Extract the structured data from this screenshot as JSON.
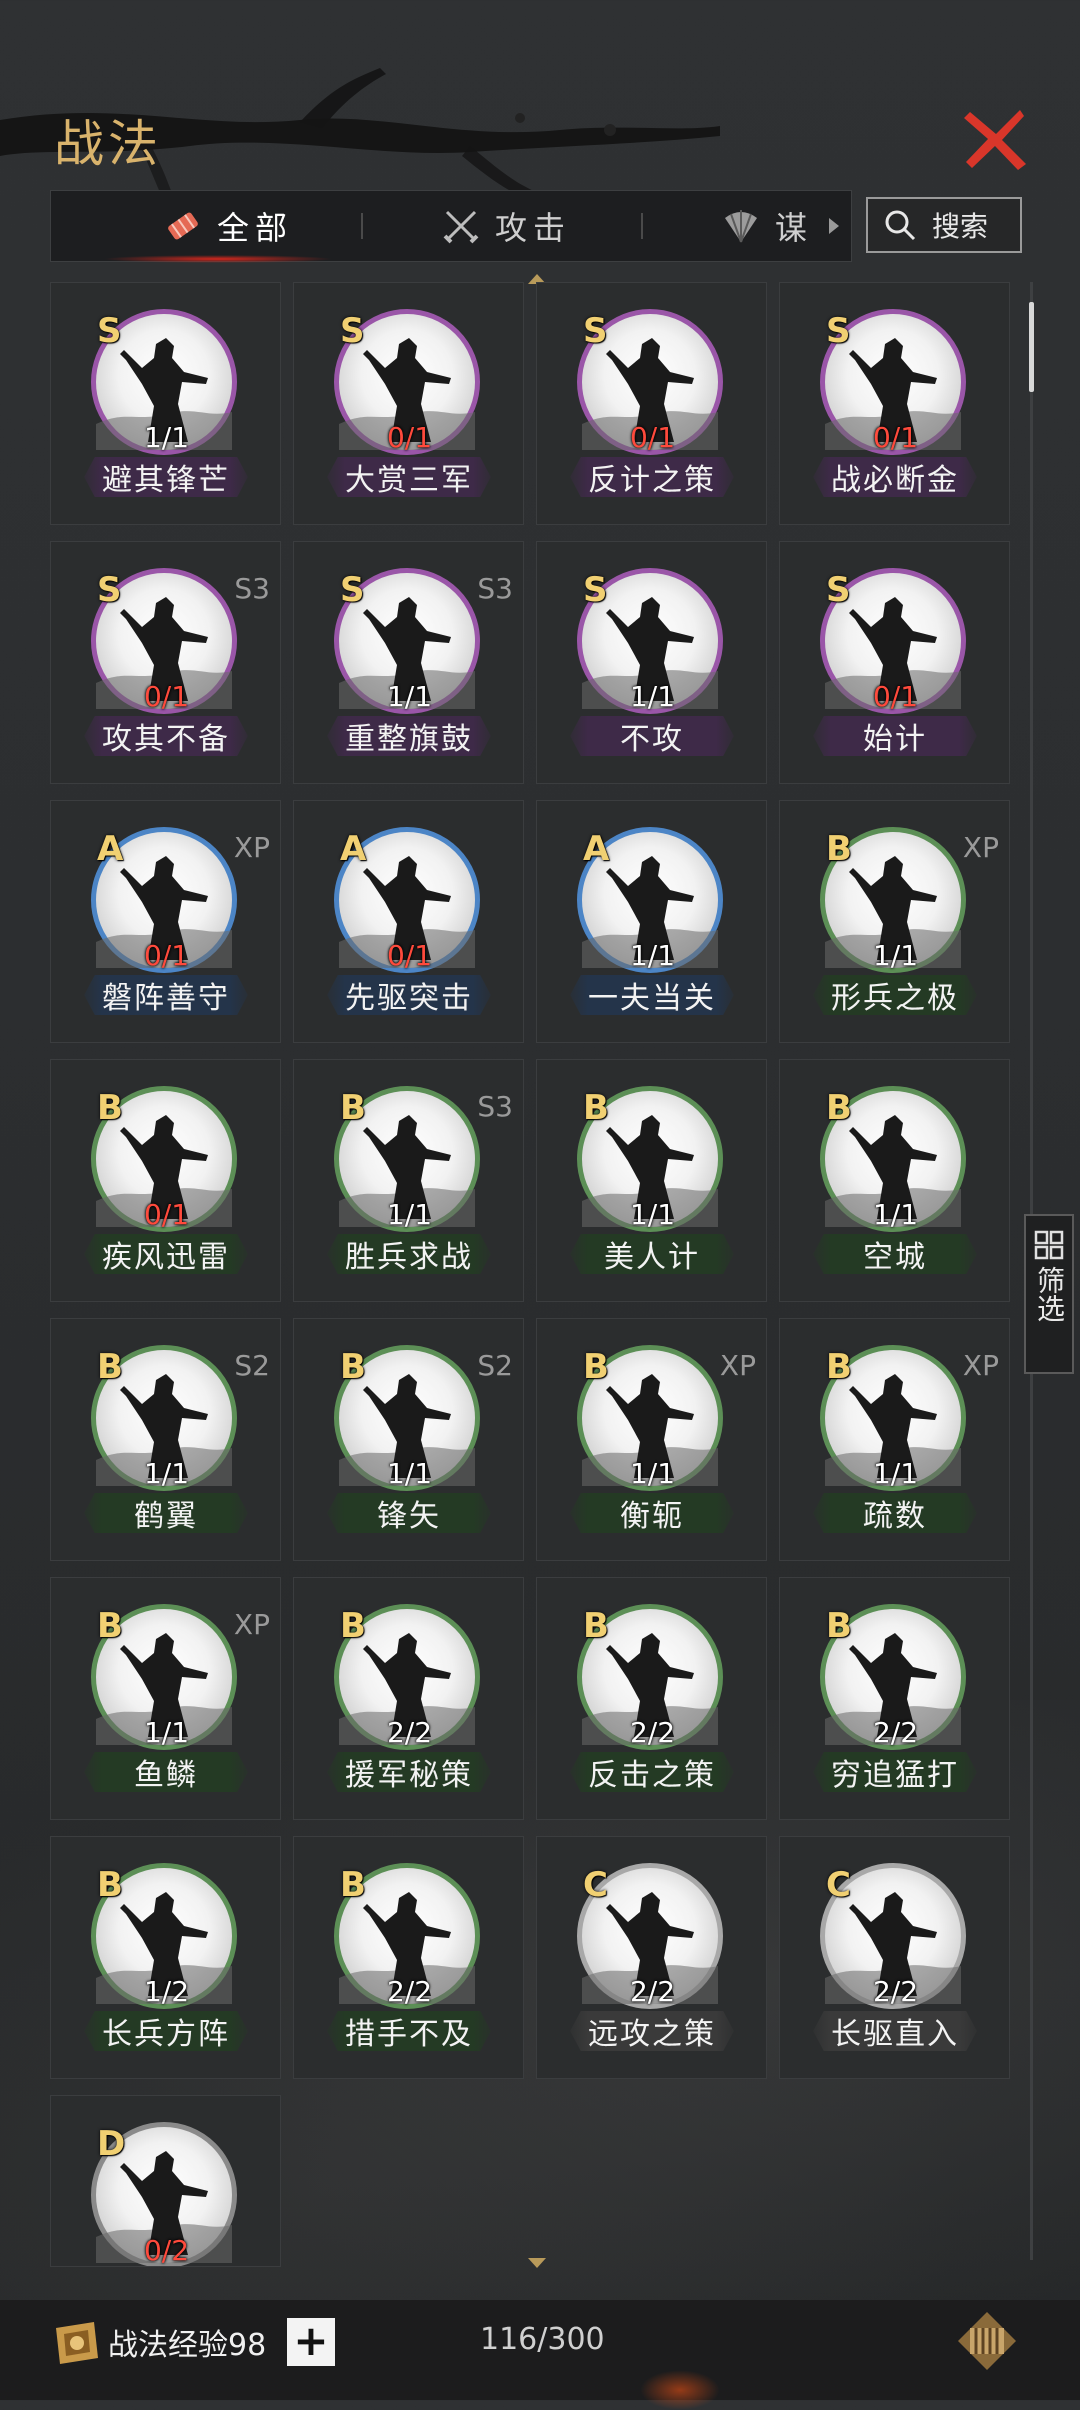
{
  "header": {
    "title": "战法"
  },
  "tabs": [
    {
      "label": "全部",
      "icon": "scroll-icon",
      "active": true
    },
    {
      "label": "攻击",
      "icon": "crossed-swords-icon",
      "active": false
    },
    {
      "label": "谋",
      "icon": "fan-icon",
      "active": false
    }
  ],
  "search": {
    "label": "搜索"
  },
  "filter": {
    "label": "筛选"
  },
  "colors": {
    "S": "#9a56a8",
    "A": "#4c85c6",
    "B": "#5c8f56",
    "C": "#a8a8a8",
    "D": "#8a8a8a",
    "accent": "#d9b36c",
    "close": "#d9362a",
    "count_red": "#ff4a3c"
  },
  "cards": [
    {
      "grade": "S",
      "tag": "",
      "count": "1/1",
      "red": false,
      "name": "避其锋芒"
    },
    {
      "grade": "S",
      "tag": "",
      "count": "0/1",
      "red": true,
      "name": "大赏三军"
    },
    {
      "grade": "S",
      "tag": "",
      "count": "0/1",
      "red": true,
      "name": "反计之策"
    },
    {
      "grade": "S",
      "tag": "",
      "count": "0/1",
      "red": true,
      "name": "战必断金"
    },
    {
      "grade": "S",
      "tag": "S3",
      "count": "0/1",
      "red": true,
      "name": "攻其不备"
    },
    {
      "grade": "S",
      "tag": "S3",
      "count": "1/1",
      "red": false,
      "name": "重整旗鼓"
    },
    {
      "grade": "S",
      "tag": "",
      "count": "1/1",
      "red": false,
      "name": "不攻"
    },
    {
      "grade": "S",
      "tag": "",
      "count": "0/1",
      "red": true,
      "name": "始计"
    },
    {
      "grade": "A",
      "tag": "XP",
      "count": "0/1",
      "red": true,
      "name": "磐阵善守"
    },
    {
      "grade": "A",
      "tag": "",
      "count": "0/1",
      "red": true,
      "name": "先驱突击"
    },
    {
      "grade": "A",
      "tag": "",
      "count": "1/1",
      "red": false,
      "name": "一夫当关"
    },
    {
      "grade": "B",
      "tag": "XP",
      "count": "1/1",
      "red": false,
      "name": "形兵之极"
    },
    {
      "grade": "B",
      "tag": "",
      "count": "0/1",
      "red": true,
      "name": "疾风迅雷"
    },
    {
      "grade": "B",
      "tag": "S3",
      "count": "1/1",
      "red": false,
      "name": "胜兵求战"
    },
    {
      "grade": "B",
      "tag": "",
      "count": "1/1",
      "red": false,
      "name": "美人计"
    },
    {
      "grade": "B",
      "tag": "",
      "count": "1/1",
      "red": false,
      "name": "空城"
    },
    {
      "grade": "B",
      "tag": "S2",
      "count": "1/1",
      "red": false,
      "name": "鹤翼"
    },
    {
      "grade": "B",
      "tag": "S2",
      "count": "1/1",
      "red": false,
      "name": "锋矢"
    },
    {
      "grade": "B",
      "tag": "XP",
      "count": "1/1",
      "red": false,
      "name": "衡轭"
    },
    {
      "grade": "B",
      "tag": "XP",
      "count": "1/1",
      "red": false,
      "name": "疏数"
    },
    {
      "grade": "B",
      "tag": "XP",
      "count": "1/1",
      "red": false,
      "name": "鱼鳞"
    },
    {
      "grade": "B",
      "tag": "",
      "count": "2/2",
      "red": false,
      "name": "援军秘策"
    },
    {
      "grade": "B",
      "tag": "",
      "count": "2/2",
      "red": false,
      "name": "反击之策"
    },
    {
      "grade": "B",
      "tag": "",
      "count": "2/2",
      "red": false,
      "name": "穷追猛打"
    },
    {
      "grade": "B",
      "tag": "",
      "count": "1/2",
      "red": false,
      "name": "长兵方阵"
    },
    {
      "grade": "B",
      "tag": "",
      "count": "2/2",
      "red": false,
      "name": "措手不及"
    },
    {
      "grade": "C",
      "tag": "",
      "count": "2/2",
      "red": false,
      "name": "远攻之策"
    },
    {
      "grade": "C",
      "tag": "",
      "count": "2/2",
      "red": false,
      "name": "长驱直入"
    },
    {
      "grade": "D",
      "tag": "",
      "count": "0/2",
      "red": true,
      "name": ""
    }
  ],
  "footer": {
    "exp_label": "战法经验98",
    "plus": "+",
    "capacity": "116/300",
    "exp_icon": "fist-scroll-icon",
    "bag_icon": "scroll-case-icon"
  }
}
